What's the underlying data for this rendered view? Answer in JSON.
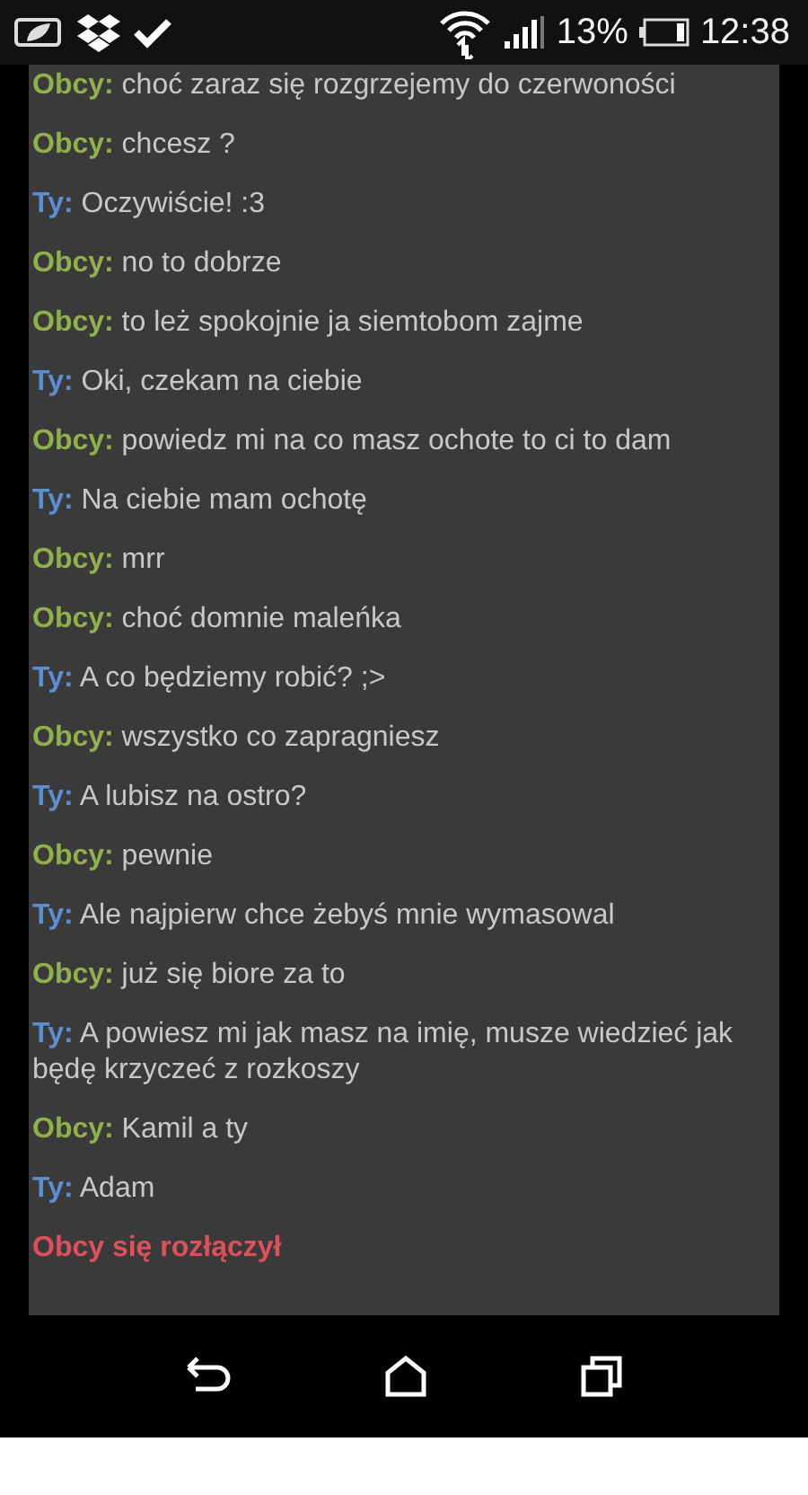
{
  "status_bar": {
    "battery_percent": "13%",
    "time": "12:38"
  },
  "messages": [
    {
      "kind": "stranger",
      "speaker": "Obcy:",
      "text": "choć zaraz się rozgrzejemy do czerwoności"
    },
    {
      "kind": "stranger",
      "speaker": "Obcy:",
      "text": "chcesz ?"
    },
    {
      "kind": "you",
      "speaker": "Ty:",
      "text": "Oczywiście! :3"
    },
    {
      "kind": "stranger",
      "speaker": "Obcy:",
      "text": "no to dobrze"
    },
    {
      "kind": "stranger",
      "speaker": "Obcy:",
      "text": "to leż spokojnie ja siemtobom zajme"
    },
    {
      "kind": "you",
      "speaker": "Ty:",
      "text": "Oki, czekam na ciebie"
    },
    {
      "kind": "stranger",
      "speaker": "Obcy:",
      "text": "powiedz mi na co masz ochote to ci to dam"
    },
    {
      "kind": "you",
      "speaker": "Ty:",
      "text": "Na ciebie mam ochotę"
    },
    {
      "kind": "stranger",
      "speaker": "Obcy:",
      "text": "mrr"
    },
    {
      "kind": "stranger",
      "speaker": "Obcy:",
      "text": "choć domnie maleńka"
    },
    {
      "kind": "you",
      "speaker": "Ty:",
      "text": "A co będziemy robić? ;>"
    },
    {
      "kind": "stranger",
      "speaker": "Obcy:",
      "text": "wszystko co zapragniesz"
    },
    {
      "kind": "you",
      "speaker": "Ty:",
      "text": "A lubisz na ostro?"
    },
    {
      "kind": "stranger",
      "speaker": "Obcy:",
      "text": "pewnie"
    },
    {
      "kind": "you",
      "speaker": "Ty:",
      "text": "Ale najpierw chce żebyś mnie wymasowal"
    },
    {
      "kind": "stranger",
      "speaker": "Obcy:",
      "text": "już się biore za to"
    },
    {
      "kind": "you",
      "speaker": "Ty:",
      "text": "A powiesz mi jak masz na imię, musze wiedzieć jak będę krzyczeć z rozkoszy"
    },
    {
      "kind": "stranger",
      "speaker": "Obcy:",
      "text": "Kamil a ty"
    },
    {
      "kind": "you",
      "speaker": "Ty:",
      "text": "Adam"
    },
    {
      "kind": "system",
      "text": "Obcy się rozłączył"
    }
  ]
}
